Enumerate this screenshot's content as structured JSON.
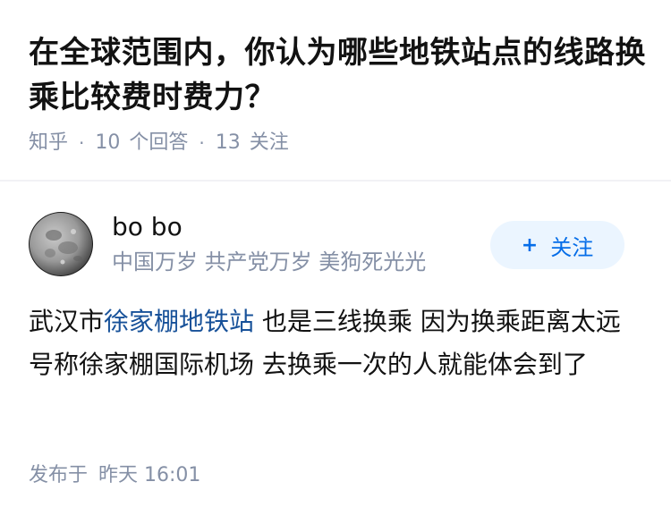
{
  "question": {
    "title": "在全球范围内，你认为哪些地铁站点的线路换乘比较费时费力？"
  },
  "meta": {
    "source": "知乎",
    "answer_count": "10",
    "answer_label": "个回答",
    "follower_count": "13",
    "follower_label": "关注"
  },
  "author": {
    "name": "bo bo",
    "bio": "中国万岁 共产党万岁 美狗死光光",
    "avatar_icon": "moon-avatar"
  },
  "follow_button": {
    "plus": "+",
    "label": "关注"
  },
  "answer": {
    "text_before": "武汉市",
    "link_text": "徐家棚地铁站",
    "text_after": " 也是三线换乘 因为换乘距离太远 号称徐家棚国际机场 去换乘一次的人就能体会到了"
  },
  "footer": {
    "posted_label": "发布于",
    "posted_time": "昨天 16:01"
  },
  "colors": {
    "primary_text": "#121212",
    "secondary_text": "#8590a6",
    "accent": "#056de8",
    "follow_bg": "#ebf5ff",
    "link": "#175199"
  }
}
